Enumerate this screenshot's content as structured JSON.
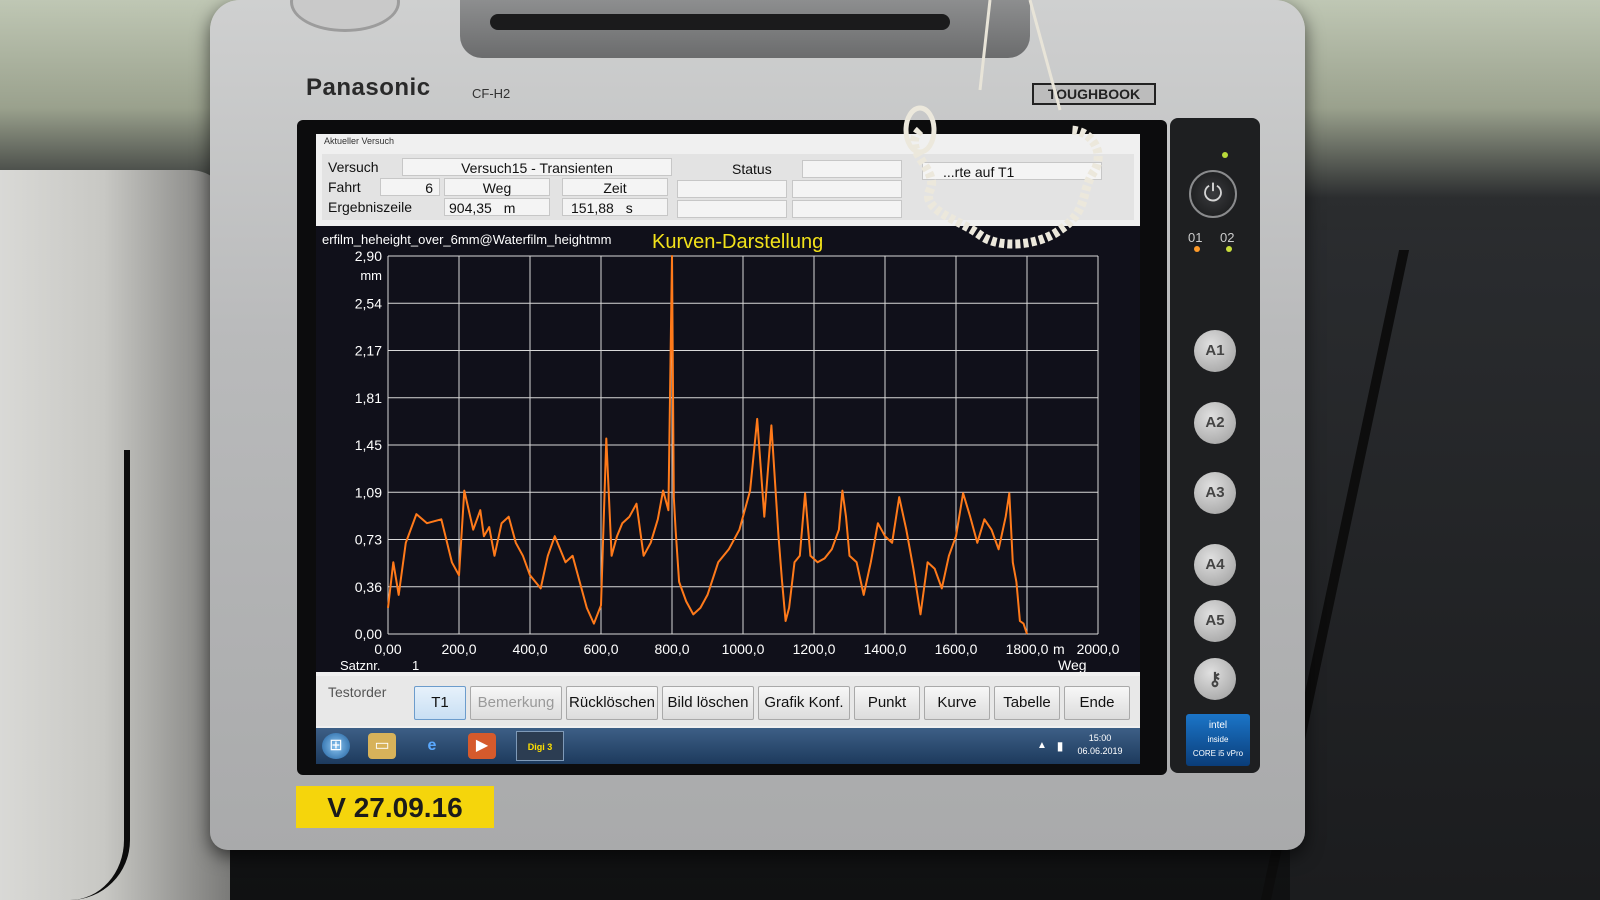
{
  "device": {
    "brand": "Panasonic",
    "model": "CF-H2",
    "badge": "TOUGHBOOK",
    "sticker": "V 27.09.16",
    "intel_line1": "intel",
    "intel_line2": "inside",
    "intel_line3": "CORE i5 vPro"
  },
  "window": {
    "title": "Aktueller Versuch"
  },
  "info": {
    "versuch_label": "Versuch",
    "versuch_value": "Versuch15 - Transienten",
    "status_label": "Status",
    "status_value": "...rte auf T1",
    "fahrt_label": "Fahrt",
    "fahrt_value": "6",
    "weg_label": "Weg",
    "zeit_label": "Zeit",
    "ergebnis_label": "Ergebniszeile",
    "weg_value": "904,35",
    "weg_unit": "m",
    "zeit_value": "151,88",
    "zeit_unit": "s"
  },
  "chart_header": {
    "channel": "erfilm_heheight_over_6mm@Waterfilm_heightmm",
    "title": "Kurven-Darstellung"
  },
  "chart_data": {
    "type": "line",
    "title": "Kurven-Darstellung",
    "xlabel": "Weg",
    "xunit": "m",
    "ylabel": "",
    "yunit": "mm",
    "xlim": [
      0,
      2000
    ],
    "ylim": [
      0,
      2.9
    ],
    "x_ticks": [
      "0,00",
      "200,0",
      "400,0",
      "600,0",
      "800,0",
      "1000,0",
      "1200,0",
      "1400,0",
      "1600,0",
      "1800,0",
      "2000,0"
    ],
    "y_ticks": [
      "0,00",
      "0,36",
      "0,73",
      "1,09",
      "1,45",
      "1,81",
      "2,17",
      "2,54",
      "2,90"
    ],
    "grid": true,
    "series": [
      {
        "color": "#ff7a1a",
        "x": [
          0,
          15,
          30,
          50,
          80,
          110,
          150,
          180,
          200,
          215,
          240,
          260,
          270,
          285,
          300,
          320,
          340,
          360,
          380,
          400,
          430,
          450,
          470,
          500,
          520,
          540,
          560,
          580,
          600,
          615,
          630,
          645,
          660,
          680,
          700,
          720,
          740,
          760,
          775,
          790,
          800,
          805,
          810,
          820,
          840,
          860,
          880,
          900,
          930,
          960,
          990,
          1020,
          1040,
          1060,
          1080,
          1100,
          1110,
          1120,
          1130,
          1145,
          1160,
          1175,
          1190,
          1210,
          1230,
          1250,
          1270,
          1280,
          1290,
          1300,
          1320,
          1340,
          1360,
          1380,
          1400,
          1420,
          1440,
          1460,
          1480,
          1500,
          1520,
          1540,
          1560,
          1580,
          1600,
          1620,
          1640,
          1660,
          1680,
          1700,
          1720,
          1740,
          1750,
          1760,
          1770,
          1780,
          1790,
          1800
        ],
        "y": [
          0.2,
          0.55,
          0.3,
          0.7,
          0.92,
          0.85,
          0.88,
          0.55,
          0.45,
          1.1,
          0.8,
          0.95,
          0.75,
          0.82,
          0.6,
          0.85,
          0.9,
          0.7,
          0.6,
          0.45,
          0.35,
          0.6,
          0.75,
          0.55,
          0.6,
          0.4,
          0.2,
          0.08,
          0.22,
          1.5,
          0.6,
          0.75,
          0.85,
          0.9,
          1.0,
          0.6,
          0.7,
          0.88,
          1.1,
          0.95,
          2.9,
          1.05,
          0.8,
          0.4,
          0.25,
          0.15,
          0.2,
          0.3,
          0.55,
          0.65,
          0.8,
          1.1,
          1.65,
          0.9,
          1.6,
          0.75,
          0.4,
          0.1,
          0.2,
          0.55,
          0.6,
          1.08,
          0.6,
          0.55,
          0.58,
          0.65,
          0.8,
          1.1,
          0.9,
          0.6,
          0.55,
          0.3,
          0.55,
          0.85,
          0.75,
          0.7,
          1.05,
          0.8,
          0.5,
          0.15,
          0.55,
          0.5,
          0.35,
          0.6,
          0.75,
          1.08,
          0.9,
          0.7,
          0.88,
          0.8,
          0.65,
          0.9,
          1.08,
          0.55,
          0.4,
          0.1,
          0.08,
          0.0
        ]
      }
    ]
  },
  "satz": {
    "label": "Satznr.",
    "value": "1"
  },
  "buttons": {
    "testorder": "Testorder",
    "t1": "T1",
    "bemerkung": "Bemerkung",
    "ruecklöschen": "Rücklöschen",
    "bild_loeschen": "Bild löschen",
    "grafik_konf": "Grafik Konf.",
    "punkt": "Punkt",
    "kurve": "Kurve",
    "tabelle": "Tabelle",
    "ende": "Ende"
  },
  "taskbar": {
    "digi": "Digi 3",
    "time": "15:00",
    "date": "06.06.2019"
  },
  "side_panel": {
    "buttons": [
      "A1",
      "A2",
      "A3",
      "A4",
      "A5"
    ],
    "label_d1": "01",
    "label_d2": "02"
  }
}
